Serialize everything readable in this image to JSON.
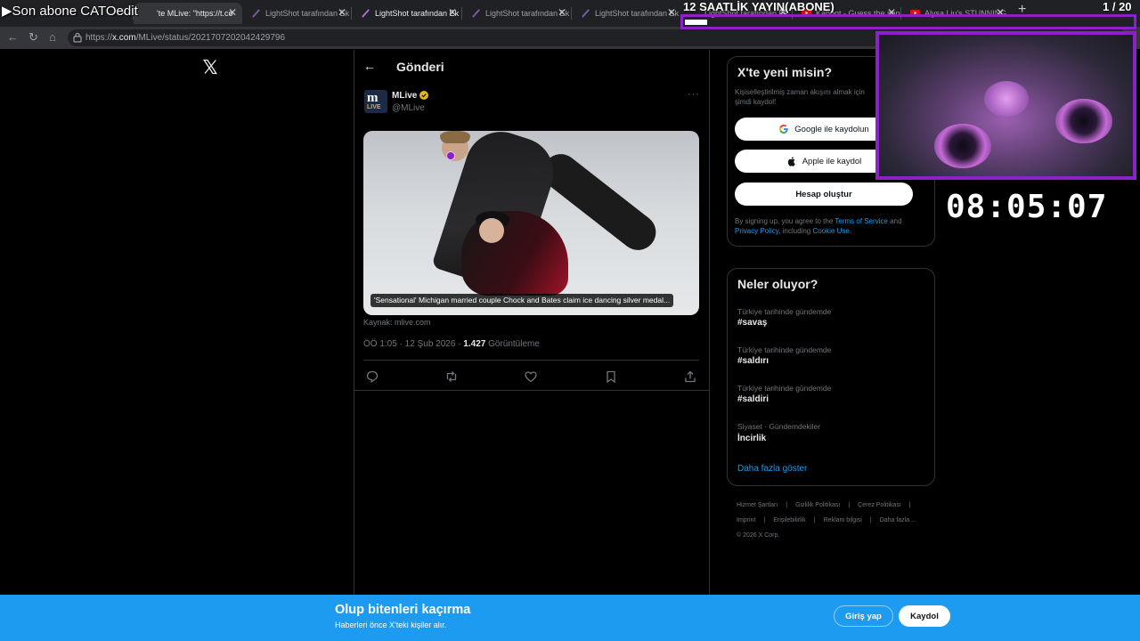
{
  "browser": {
    "tabs": [
      {
        "label": "Son abone CATOedit"
      },
      {
        "label": "'te MLive: \"https://t.co"
      },
      {
        "label": "LightShot tarafından Ek"
      },
      {
        "label": "LightShot tarafından Ek"
      },
      {
        "label": "LightShot tarafından Ek"
      },
      {
        "label": "LightShot tarafından Ek"
      },
      {
        "label": "LightShot tarafından Ek"
      },
      {
        "label": "Kahoot - Guess the song"
      },
      {
        "label": "Alysa Liu's STUNNING"
      }
    ],
    "url_prefix": "https://",
    "url_host": "x.com",
    "url_path": "/MLive/status/2021707202042429796"
  },
  "overlay": {
    "left_text": "▶Son abone CATOedit",
    "title": "12 SAATLİK YAYIN(ABONE)",
    "counter": "1 / 20",
    "progress_fraction": 0.05,
    "accent_color": "#8b22c8",
    "timer": "08:05:07"
  },
  "post": {
    "header_title": "Gönderi",
    "avatar_text": "m",
    "avatar_sub": "LIVE",
    "display_name": "MLive",
    "handle": "@MLive",
    "more": "···",
    "media_caption": "'Sensational' Michigan married couple Chock and Bates claim ice dancing silver medal...",
    "source": "Kaynak: mlive.com",
    "time": "ÖÖ 1:05 · 12 Şub 2026 · ",
    "views_count": "1.427",
    "views_label": " Görüntüleme"
  },
  "sidebar": {
    "signup": {
      "title": "X'te yeni misin?",
      "subtitle": "Kişiselleştirilmiş zaman akışını almak için şimdi kaydol!",
      "google": "Google ile kaydolun",
      "apple": "Apple ile kaydol",
      "create": "Hesap oluştur",
      "legal_1": "By signing up, you agree to the ",
      "terms": "Terms of Service",
      "legal_2": " and ",
      "privacy": "Privacy Policy",
      "legal_3": ", including ",
      "cookie": "Cookie Use",
      "legal_4": "."
    },
    "trends": {
      "title": "Neler oluyor?",
      "items": [
        {
          "context": "Türkiye tarihinde gündemde",
          "name": "#savaş"
        },
        {
          "context": "Türkiye tarihinde gündemde",
          "name": "#saldırı"
        },
        {
          "context": "Türkiye tarihinde gündemde",
          "name": "#saldiri"
        },
        {
          "context": "Siyaset · Gündemdekiler",
          "name": "İncirlik"
        }
      ],
      "show_more": "Daha fazla göster"
    },
    "footer": [
      "Hizmet Şartları",
      "|",
      "Gizlilik Politikası",
      "|",
      "Çerez Politikası",
      "|",
      "Imprint",
      "|",
      "Erişilebilirlik",
      "|",
      "Reklam bilgisi",
      "|",
      "Daha fazla ...",
      "© 2026 X Corp."
    ]
  },
  "banner": {
    "title": "Olup bitenleri kaçırma",
    "subtitle": "Haberleri önce X'teki kişiler alır.",
    "login": "Giriş yap",
    "signup": "Kaydol",
    "color": "#1d9bf0"
  }
}
